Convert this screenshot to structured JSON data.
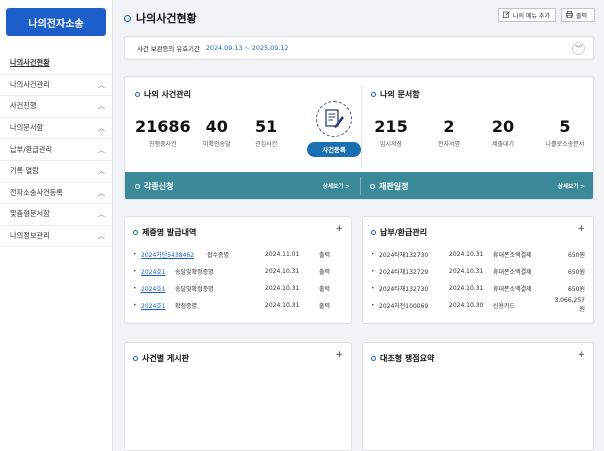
{
  "sidebar": {
    "logo": "나의전자소송",
    "items": [
      {
        "label": "나의사건현황",
        "active": true,
        "chevron": false
      },
      {
        "label": "나의사건관리",
        "chevron": true
      },
      {
        "label": "사건진행",
        "chevron": true
      },
      {
        "label": "나의문서함",
        "chevron": true
      },
      {
        "label": "납부/환급관리",
        "chevron": true
      },
      {
        "label": "기록 열람",
        "chevron": true
      },
      {
        "label": "전자소송사건등록",
        "chevron": true
      },
      {
        "label": "맞춤형문서함",
        "chevron": true
      },
      {
        "label": "나의정보관리",
        "chevron": true
      }
    ]
  },
  "header": {
    "title": "나의사건현황",
    "add_menu_label": "나의 메뉴 추가",
    "print_label": "출력"
  },
  "period": {
    "label": "사건 보관등의 유효기간",
    "range": "2024.09.13 ~ 2025.09.12"
  },
  "case_mgmt": {
    "title": "나의 사건관리",
    "stats": [
      {
        "num": "21686",
        "label": "진행중사건"
      },
      {
        "num": "40",
        "label": "미확인송달"
      },
      {
        "num": "51",
        "label": "관심사건"
      }
    ],
    "register_label": "사건등록"
  },
  "doc_box": {
    "title": "나의 문서함",
    "stats": [
      {
        "num": "215",
        "label": "임시저장"
      },
      {
        "num": "2",
        "label": "전자서명"
      },
      {
        "num": "20",
        "label": "제출대기"
      },
      {
        "num": "5",
        "label": "나홀로소송문서"
      }
    ]
  },
  "teal": {
    "left_title": "각종신청",
    "right_title": "재판일정",
    "more": "상세보기 >"
  },
  "cert": {
    "title": "제증명 발급내역",
    "plus": "+",
    "rows": [
      {
        "no": "2024가단5438462",
        "type": "접수증명",
        "date": "2024.11.01",
        "action": "출력"
      },
      {
        "no": "2024호1",
        "type": "송달및확정증명",
        "date": "2024.10.31",
        "action": "출력"
      },
      {
        "no": "2024호1",
        "type": "송달및확정증명",
        "date": "2024.10.31",
        "action": "출력"
      },
      {
        "no": "2024호1",
        "type": "확정증명",
        "date": "2024.10.31",
        "action": "출력"
      }
    ]
  },
  "payment": {
    "title": "납부/환급관리",
    "plus": "+",
    "rows": [
      {
        "no": "2024타채132730",
        "date": "2024.10.31",
        "method": "휴대폰소액결제",
        "amount": "650원"
      },
      {
        "no": "2024타채132729",
        "date": "2024.10.31",
        "method": "휴대폰소액결제",
        "amount": "650원"
      },
      {
        "no": "2024타채132730",
        "date": "2024.10.31",
        "method": "휴대폰소액결제",
        "amount": "650원"
      },
      {
        "no": "2024차전100069",
        "date": "2024.10.30",
        "method": "신용카드",
        "amount": "3,066,257원"
      }
    ]
  },
  "board": {
    "title": "사건별 게시판",
    "plus": "+"
  },
  "compare": {
    "title": "대조형 쟁점요약",
    "plus": "+"
  },
  "colors": {
    "primary": "#1c5fc8",
    "teal": "#3a8a9a",
    "register": "#1a6fb0"
  }
}
